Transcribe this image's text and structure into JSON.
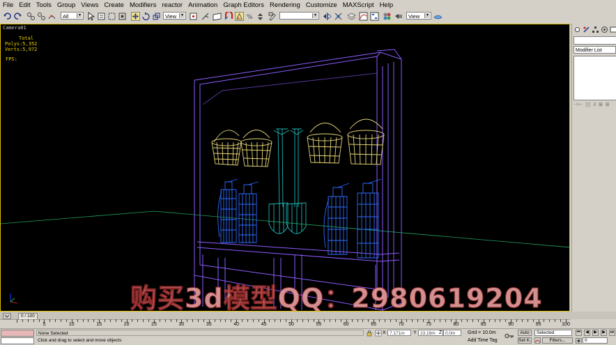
{
  "menu": [
    "File",
    "Edit",
    "Tools",
    "Group",
    "Views",
    "Create",
    "Modifiers",
    "reactor",
    "Animation",
    "Graph Editors",
    "Rendering",
    "Customize",
    "MAXScript",
    "Help"
  ],
  "toolbar": {
    "selection_filter": "All",
    "ref_coord": "View",
    "named_selection": "",
    "render_type": "View"
  },
  "viewport": {
    "label": "Camera01",
    "stats_header": "Total",
    "polys_label": "Polys:",
    "polys_value": "5,352",
    "verts_label": "Verts:",
    "verts_value": "5,972",
    "fps_label": "FPS:",
    "watermark": "购买3d模型QQ：2980619204"
  },
  "command_panel": {
    "modifier_list": "Modifier List",
    "stack_buttons": "⊣⊢ ||| ∂ ⊠ ⊞"
  },
  "timeline": {
    "slider": "0 / 100",
    "ticks": [
      5,
      10,
      15,
      20,
      25,
      30,
      35,
      40,
      45,
      50,
      55,
      60,
      65,
      70,
      75,
      80,
      85,
      90,
      95,
      100
    ]
  },
  "status": {
    "selected": "None Selected",
    "prompt": "Click and drag to select and move objects",
    "x_label": "X",
    "x_value": "7.171m",
    "y_label": "Y",
    "y_value": "23.16m",
    "z_label": "Z",
    "z_value": "0.0m",
    "grid": "Grid = 10.0m",
    "add_time_tag": "Add Time Tag",
    "auto_key": "Auto",
    "set_key": "Set K.",
    "selected_set": "Selected",
    "filters": "Filters...",
    "frame": "0"
  },
  "colors": {
    "viewport_bg": "#000000",
    "active_border": "#e0c000",
    "frame_wire": "#8c5cff",
    "bucket_wire": "#e8d878",
    "shovel_wire": "#20b8b8",
    "extinguisher_wire": "#2e6cff",
    "grid_line": "#20a060",
    "stats_text": "#e8d000"
  }
}
